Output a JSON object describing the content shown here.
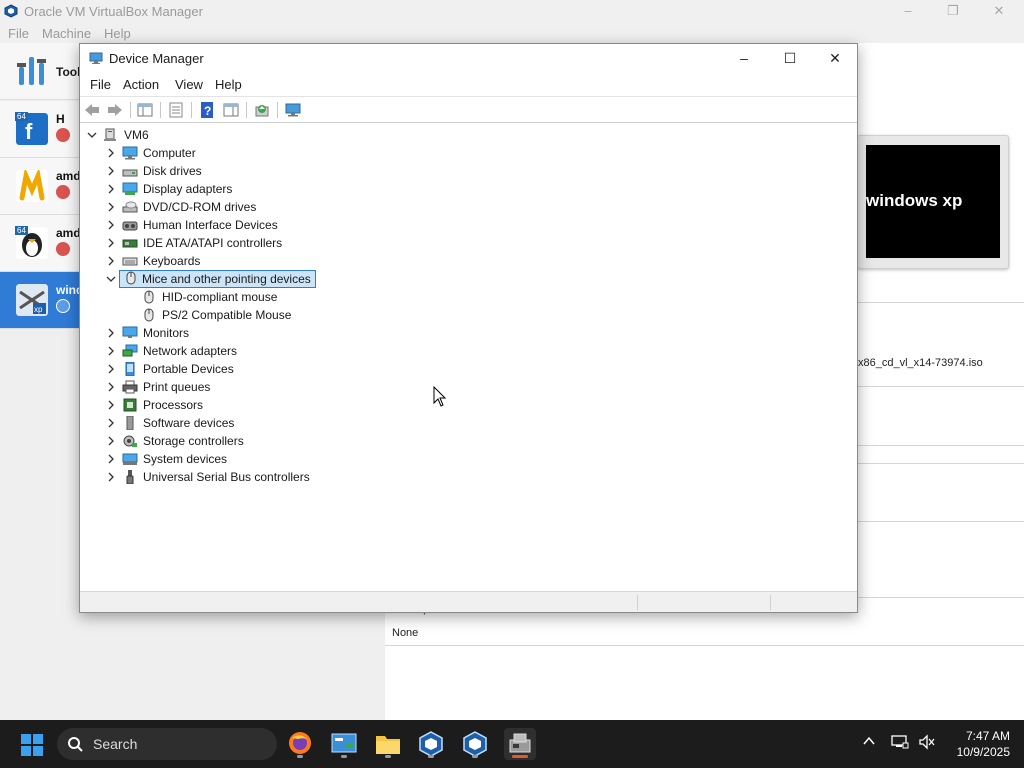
{
  "vbox": {
    "title": "Oracle VM VirtualBox Manager",
    "menu": [
      "File",
      "Machine",
      "Help"
    ],
    "tools_label": "Tools",
    "vms": [
      {
        "name": "H",
        "badge": "64",
        "state": "A"
      },
      {
        "name": "amd",
        "badge": "",
        "state": "A"
      },
      {
        "name": "amd",
        "badge": "64",
        "state": "A"
      },
      {
        "name": "wind",
        "badge": "",
        "state": "P"
      }
    ],
    "preview_text": "windows xp",
    "iso_text": "x86_cd_vl_x14-73974.iso",
    "description_label": "Description",
    "description_value": "None"
  },
  "devmgr": {
    "title": "Device Manager",
    "menu": [
      "File",
      "Action",
      "View",
      "Help"
    ],
    "root": "VM6",
    "categories": [
      {
        "label": "Computer",
        "icon": "computer-icon",
        "expanded": false
      },
      {
        "label": "Disk drives",
        "icon": "disk-drive-icon",
        "expanded": false
      },
      {
        "label": "Display adapters",
        "icon": "display-adapter-icon",
        "expanded": false
      },
      {
        "label": "DVD/CD-ROM drives",
        "icon": "dvd-drive-icon",
        "expanded": false
      },
      {
        "label": "Human Interface Devices",
        "icon": "hid-icon",
        "expanded": false
      },
      {
        "label": "IDE ATA/ATAPI controllers",
        "icon": "ide-controller-icon",
        "expanded": false
      },
      {
        "label": "Keyboards",
        "icon": "keyboard-icon",
        "expanded": false
      },
      {
        "label": "Mice and other pointing devices",
        "icon": "mouse-icon",
        "expanded": true,
        "selected": true,
        "children": [
          "HID-compliant mouse",
          "PS/2 Compatible Mouse"
        ]
      },
      {
        "label": "Monitors",
        "icon": "monitor-icon",
        "expanded": false
      },
      {
        "label": "Network adapters",
        "icon": "network-adapter-icon",
        "expanded": false
      },
      {
        "label": "Portable Devices",
        "icon": "portable-device-icon",
        "expanded": false
      },
      {
        "label": "Print queues",
        "icon": "printer-icon",
        "expanded": false
      },
      {
        "label": "Processors",
        "icon": "processor-icon",
        "expanded": false
      },
      {
        "label": "Software devices",
        "icon": "software-device-icon",
        "expanded": false
      },
      {
        "label": "Storage controllers",
        "icon": "storage-controller-icon",
        "expanded": false
      },
      {
        "label": "System devices",
        "icon": "system-device-icon",
        "expanded": false
      },
      {
        "label": "Universal Serial Bus controllers",
        "icon": "usb-icon",
        "expanded": false
      }
    ]
  },
  "taskbar": {
    "search_placeholder": "Search",
    "apps": [
      "firefox-icon",
      "control-panel-icon",
      "file-explorer-icon",
      "virtualbox-icon",
      "virtualbox-icon",
      "device-manager-icon"
    ],
    "time": "7:47 AM",
    "date": "10/9/2025"
  },
  "colors": {
    "selection_blue": "#2f7bd6",
    "tree_selection_bg": "#cce4f7",
    "tree_selection_border": "#2e7dd1",
    "taskbar_bg": "#1c1c1c",
    "active_app_indicator": "#e05a2b"
  }
}
